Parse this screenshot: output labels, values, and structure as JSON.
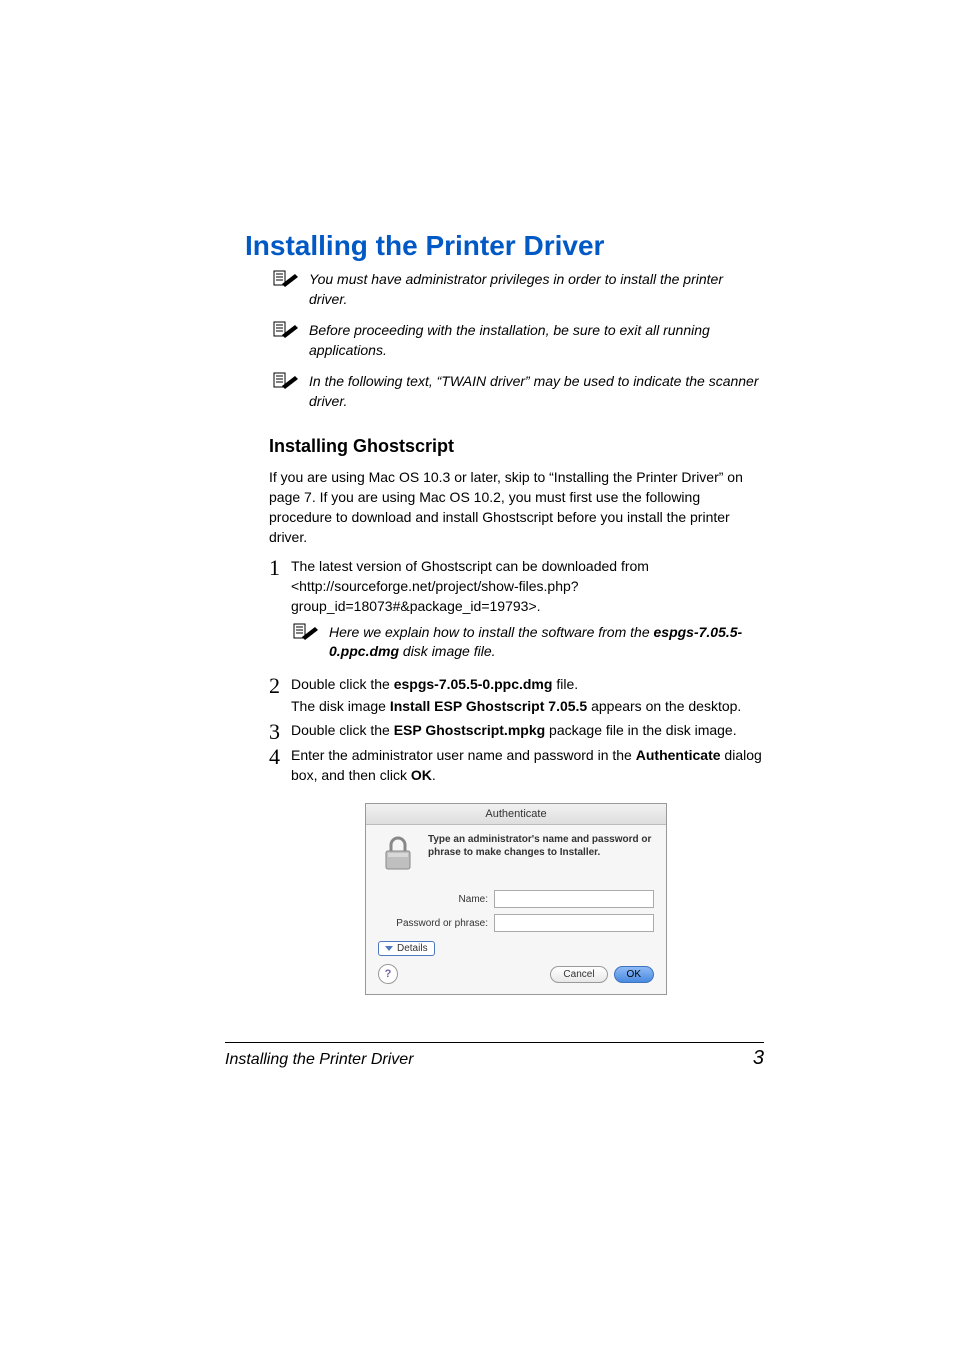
{
  "title": "Installing the Printer Driver",
  "notes": [
    "You must have administrator privileges in order to install the printer driver.",
    "Before proceeding with the installation, be sure to exit all running applications.",
    "In the following text, “TWAIN driver” may be used to indicate the scanner driver."
  ],
  "section_title": "Installing Ghostscript",
  "section_intro": "If you are using Mac OS 10.3 or later, skip to “Installing the Printer Driver” on page 7. If you are using Mac OS 10.2, you must first use the following procedure to download and install Ghostscript before you install the printer driver.",
  "step1": {
    "text": "The latest version of Ghostscript can be downloaded from <http://sourceforge.net/project/show-files.php?group_id=18073#&package_id=19793>."
  },
  "inline_note_pre": "Here we explain how to install the software from the ",
  "inline_note_bold": "espgs-7.05.5-0.ppc.dmg",
  "inline_note_post": " disk image file.",
  "step2": {
    "pre": "Double click the ",
    "bold": "espgs-7.05.5-0.ppc.dmg",
    "post": " file.",
    "sub_pre": "The disk image ",
    "sub_bold": "Install ESP Ghostscript 7.05.5",
    "sub_post": " appears on the desktop."
  },
  "step3": {
    "pre": "Double click the ",
    "bold": "ESP Ghostscript.mpkg",
    "post": " package file in the disk image."
  },
  "step4": {
    "pre": "Enter the administrator user name and password in the ",
    "bold1": "Authenticate",
    "mid": " dialog box, and then click ",
    "bold2": "OK",
    "post": "."
  },
  "dialog": {
    "title": "Authenticate",
    "message": "Type an administrator's name and password or phrase to make changes to Installer.",
    "name_label": "Name:",
    "pass_label": "Password or phrase:",
    "details": "Details",
    "help": "?",
    "cancel": "Cancel",
    "ok": "OK"
  },
  "footer": {
    "title": "Installing the Printer Driver",
    "page": "3"
  }
}
